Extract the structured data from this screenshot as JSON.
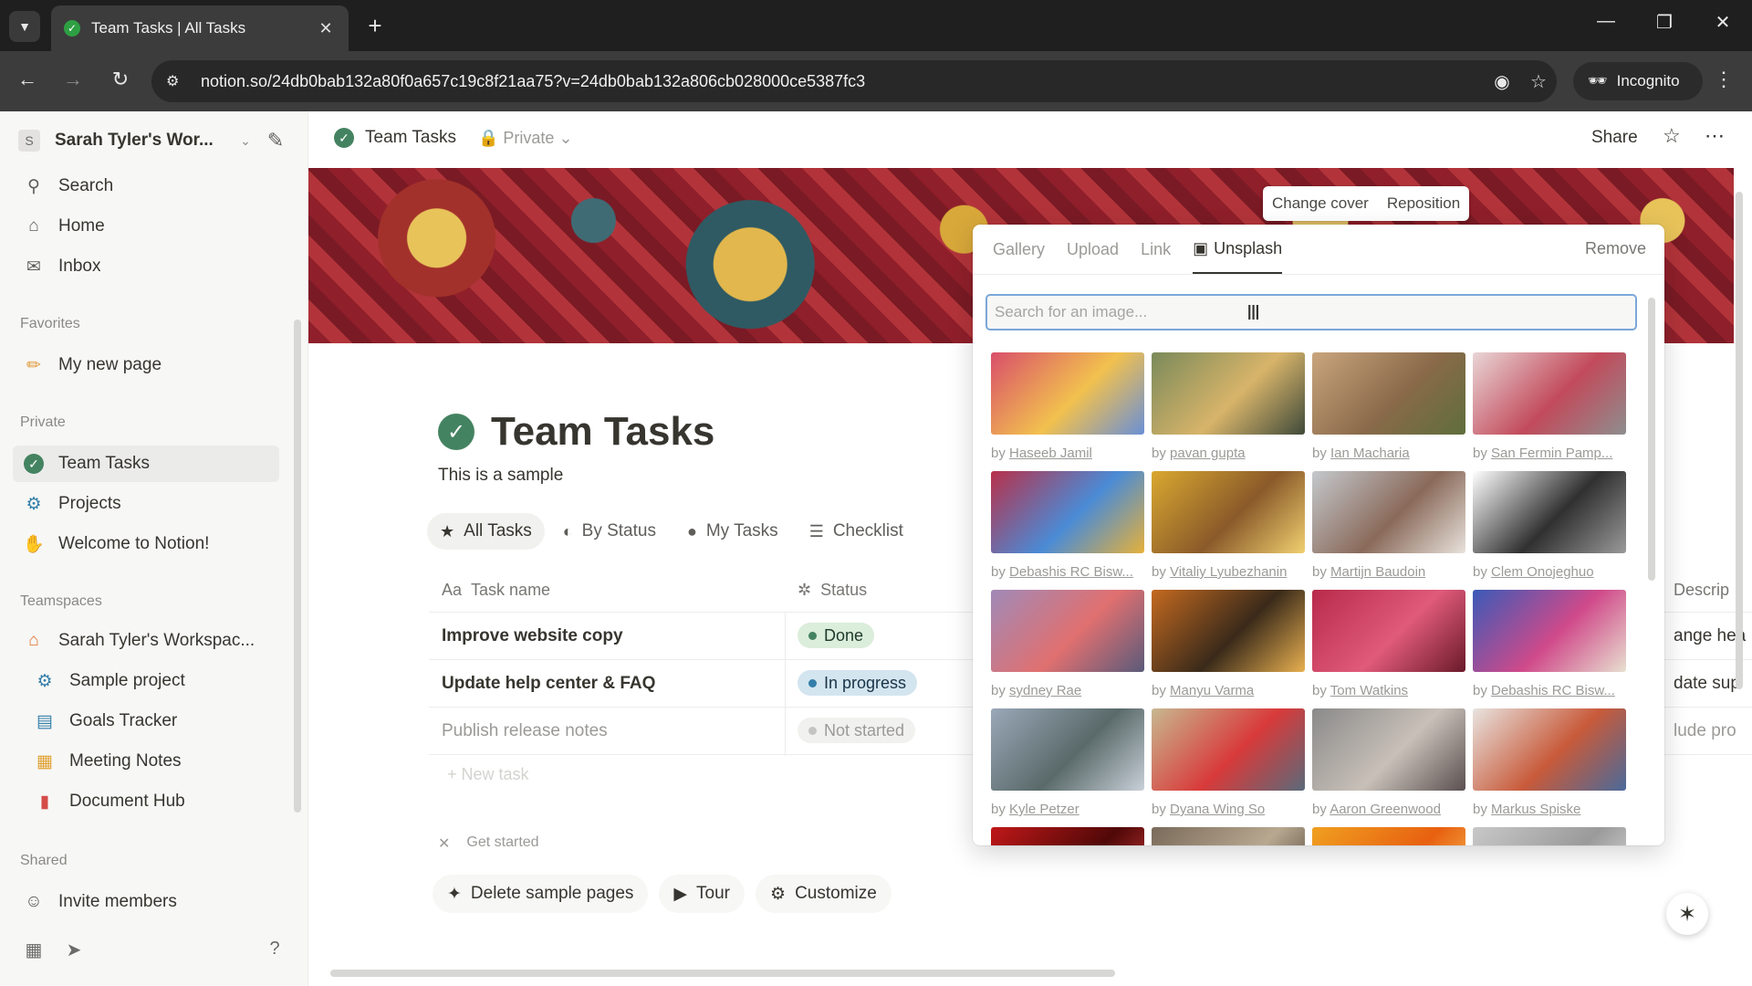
{
  "browser": {
    "tab_title": "Team Tasks | All Tasks",
    "url": "notion.so/24db0bab132a80f0a657c19c8f21aa75?v=24db0bab132a806cb028000ce5387fc3",
    "incognito_label": "Incognito"
  },
  "sidebar": {
    "workspace_initial": "S",
    "workspace_name": "Sarah Tyler's Wor...",
    "top_items": [
      {
        "label": "Search",
        "icon": "search-icon"
      },
      {
        "label": "Home",
        "icon": "home-icon"
      },
      {
        "label": "Inbox",
        "icon": "inbox-icon"
      }
    ],
    "favorites_heading": "Favorites",
    "favorites": [
      {
        "label": "My new page",
        "icon": "pencil-icon"
      }
    ],
    "private_heading": "Private",
    "private": [
      {
        "label": "Team Tasks",
        "icon": "check-circle-icon"
      },
      {
        "label": "Projects",
        "icon": "projects-icon"
      },
      {
        "label": "Welcome to Notion!",
        "icon": "wave-icon"
      }
    ],
    "teamspaces_heading": "Teamspaces",
    "teamspace": {
      "label": "Sarah Tyler's Workspac...",
      "icon": "house-icon"
    },
    "teamspace_items": [
      {
        "label": "Sample project",
        "icon": "projects-icon"
      },
      {
        "label": "Goals Tracker",
        "icon": "chart-icon"
      },
      {
        "label": "Meeting Notes",
        "icon": "calendar-icon"
      },
      {
        "label": "Document Hub",
        "icon": "document-icon"
      }
    ],
    "shared_heading": "Shared",
    "invite_label": "Invite members"
  },
  "topbar": {
    "page_name": "Team Tasks",
    "privacy": "Private",
    "share_label": "Share"
  },
  "cover": {
    "change_cover": "Change cover",
    "reposition": "Reposition"
  },
  "page": {
    "title": "Team Tasks",
    "description": "This is a sample",
    "views": [
      {
        "label": "All Tasks",
        "icon": "star-icon",
        "active": true
      },
      {
        "label": "By Status",
        "icon": "status-icon",
        "active": false
      },
      {
        "label": "My Tasks",
        "icon": "person-icon",
        "active": false
      },
      {
        "label": "Checklist",
        "icon": "checklist-icon",
        "active": false
      }
    ],
    "columns": {
      "name": "Task name",
      "status": "Status",
      "description": "Descrip"
    },
    "rows": [
      {
        "name": "Improve website copy",
        "status": "Done",
        "status_color": "#448361",
        "status_bg": "#dbeddb",
        "desc": "ange hea"
      },
      {
        "name": "Update help center & FAQ",
        "status": "In progress",
        "status_color": "#337ea9",
        "status_bg": "#d3e5ef",
        "desc": "date sup"
      },
      {
        "name": "Publish release notes",
        "status": "Not started",
        "status_color": "#9b9a97",
        "status_bg": "#f1f1ef",
        "desc": "lude pro"
      }
    ],
    "new_row": "New task",
    "get_started": "Get started",
    "actions": [
      {
        "label": "Delete sample pages",
        "icon": "sparkle-icon"
      },
      {
        "label": "Tour",
        "icon": "play-icon"
      },
      {
        "label": "Customize",
        "icon": "gear-icon"
      }
    ]
  },
  "picker": {
    "tabs": [
      {
        "label": "Gallery",
        "active": false
      },
      {
        "label": "Upload",
        "active": false
      },
      {
        "label": "Link",
        "active": false
      },
      {
        "label": "Unsplash",
        "active": true
      }
    ],
    "remove_label": "Remove",
    "search_placeholder": "Search for an image...",
    "by_prefix": "by",
    "photos": [
      {
        "author": "Haseeb Jamil",
        "colors": [
          "#d94f6b",
          "#f2c14e",
          "#6a8fd6"
        ]
      },
      {
        "author": "pavan gupta",
        "colors": [
          "#7a8a5a",
          "#d8b46a",
          "#3f4a3a"
        ]
      },
      {
        "author": "Ian Macharia",
        "colors": [
          "#c9a57d",
          "#8a6a4a",
          "#5f6e3b"
        ]
      },
      {
        "author": "San Fermin Pamp...",
        "colors": [
          "#e9d6d6",
          "#c24a5b",
          "#8e8e8e"
        ]
      },
      {
        "author": "Debashis RC Bisw...",
        "colors": [
          "#b8304a",
          "#4a8bd6",
          "#e6b13b"
        ]
      },
      {
        "author": "Vitaliy Lyubezhanin",
        "colors": [
          "#d9a830",
          "#8a5a2a",
          "#f0d070"
        ]
      },
      {
        "author": "Martijn Baudoin",
        "colors": [
          "#c4c8cc",
          "#8a6a5a",
          "#e8e2dc"
        ]
      },
      {
        "author": "Clem Onojeghuo",
        "colors": [
          "#ffffff",
          "#303030",
          "#9a9a9a"
        ]
      },
      {
        "author": "sydney Rae",
        "colors": [
          "#a08ab8",
          "#e07070",
          "#5a5a7a"
        ]
      },
      {
        "author": "Manyu Varma",
        "colors": [
          "#c46a20",
          "#3a2a1a",
          "#e8b050"
        ]
      },
      {
        "author": "Tom Watkins",
        "colors": [
          "#b82a4a",
          "#e05a7a",
          "#6a1a2a"
        ]
      },
      {
        "author": "Debashis RC Bisw...",
        "colors": [
          "#3a5ab8",
          "#d04a8a",
          "#e8e0d0"
        ]
      },
      {
        "author": "Kyle Petzer",
        "colors": [
          "#9aa8b8",
          "#5a6a6a",
          "#c8d0d8"
        ]
      },
      {
        "author": "Dyana Wing So",
        "colors": [
          "#c8b890",
          "#d83a3a",
          "#5a6a7a"
        ]
      },
      {
        "author": "Aaron Greenwood",
        "colors": [
          "#8a8a8a",
          "#c8c0b8",
          "#5a5050"
        ]
      },
      {
        "author": "Markus Spiske",
        "colors": [
          "#e8e4e0",
          "#c85a3a",
          "#4a6a9a"
        ]
      },
      {
        "author": "",
        "colors": [
          "#c01818",
          "#500808",
          "#e04040"
        ]
      },
      {
        "author": "",
        "colors": [
          "#7a6a5a",
          "#b8a890",
          "#3a3028"
        ]
      },
      {
        "author": "",
        "colors": [
          "#f0a020",
          "#e86010",
          "#f8d060"
        ]
      },
      {
        "author": "",
        "colors": [
          "#c8c8c8",
          "#9a9a9a",
          "#e8e8e8"
        ]
      }
    ]
  }
}
